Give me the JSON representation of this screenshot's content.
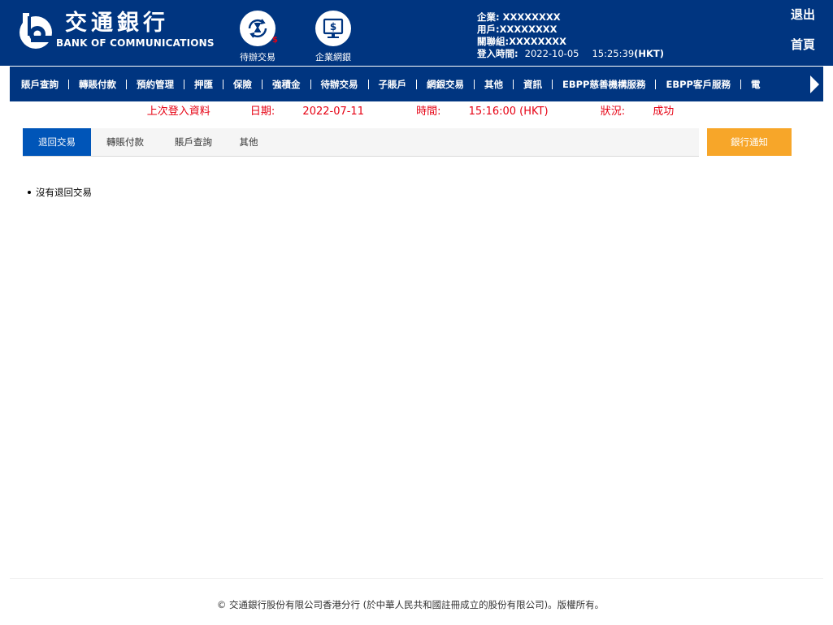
{
  "brand": {
    "name_cn": "交通銀行",
    "name_en": "BANK OF COMMUNICATIONS"
  },
  "quick_icons": [
    {
      "label": "待辦交易",
      "icon": "hourglass-refresh-icon",
      "badge": "$"
    },
    {
      "label": "企業網銀",
      "icon": "monitor-dollar-icon"
    }
  ],
  "user": {
    "company_label": "企業:",
    "company": "XXXXXXXX",
    "user_label": "用戶:",
    "user": "XXXXXXXX",
    "group_label": "關聯組:",
    "group": "XXXXXXXX",
    "login_label": "登入時間:",
    "login_date": "2022-10-05",
    "login_time": "15:25:39",
    "login_tz": "(HKT)"
  },
  "top_links": {
    "logout": "退出",
    "home": "首頁"
  },
  "nav": {
    "items": [
      "賬戶查詢",
      "轉賬付款",
      "預約管理",
      "押匯",
      "保險",
      "強積金",
      "待辦交易",
      "子賬戶",
      "網銀交易",
      "其他",
      "資訊",
      "EBPP慈善機構服務",
      "EBPP客戶服務",
      "電"
    ]
  },
  "last_login": {
    "title": "上次登入資料",
    "date_label": "日期:",
    "date": "2022-07-11",
    "time_label": "時間:",
    "time": "15:16:00 (HKT)",
    "status_label": "狀況:",
    "status": "成功"
  },
  "tabs": [
    {
      "label": "退回交易",
      "active": true
    },
    {
      "label": "轉賬付款",
      "active": false
    },
    {
      "label": "賬戶查詢",
      "active": false
    },
    {
      "label": "其他",
      "active": false
    }
  ],
  "notice_button": "銀行通知",
  "content": {
    "message": "沒有退回交易"
  },
  "footer": {
    "text": "© 交通銀行股份有限公司香港分行 (於中華人民共和國註冊成立的股份有限公司)。版權所有。"
  },
  "colors": {
    "brand_blue": "#003580",
    "tab_active": "#0055b8",
    "notice_orange": "#f7a629",
    "alert_red": "#e60012"
  }
}
